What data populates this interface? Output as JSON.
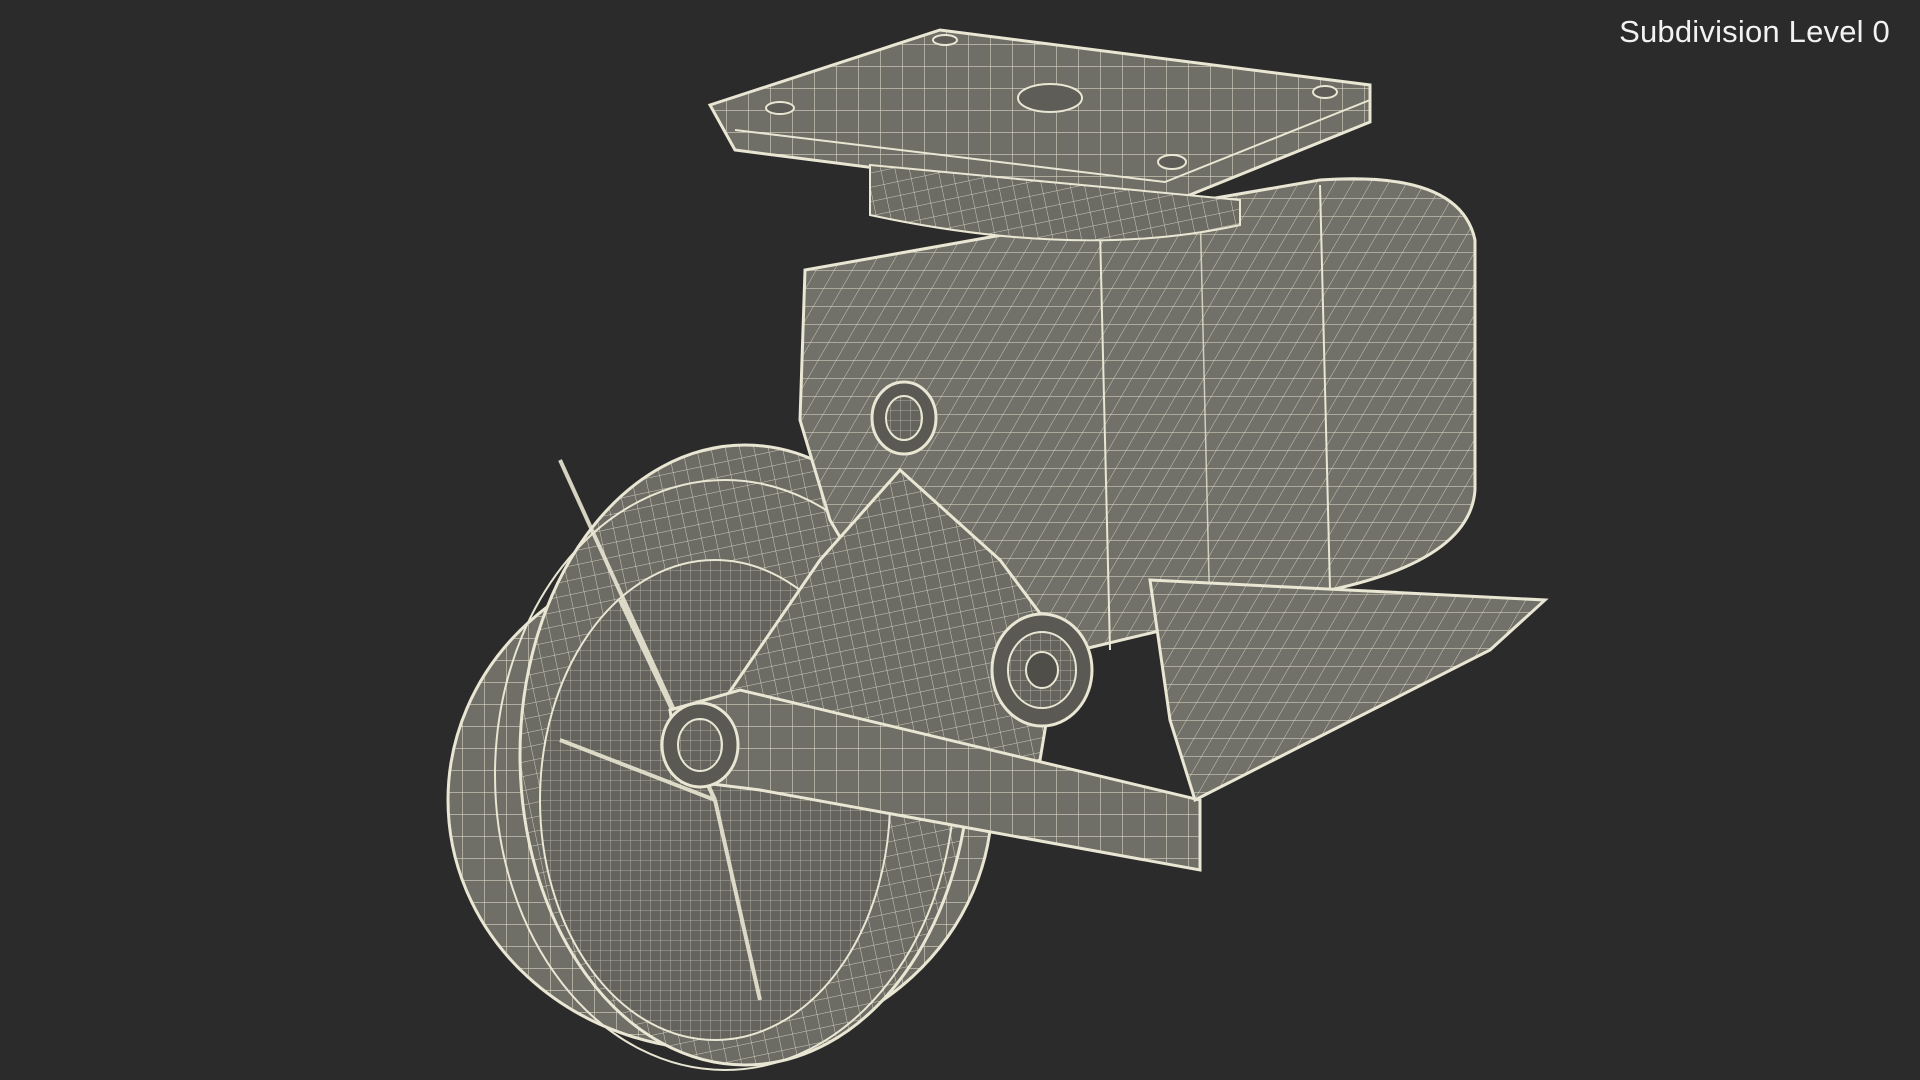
{
  "viewport": {
    "label": "Subdivision Level 0",
    "background_color": "#2b2b2b",
    "mesh_fill_color": "#6f6e67",
    "wire_color": "#e9e6d3"
  },
  "model": {
    "icon": "caster-wheel-wireframe-icon"
  }
}
